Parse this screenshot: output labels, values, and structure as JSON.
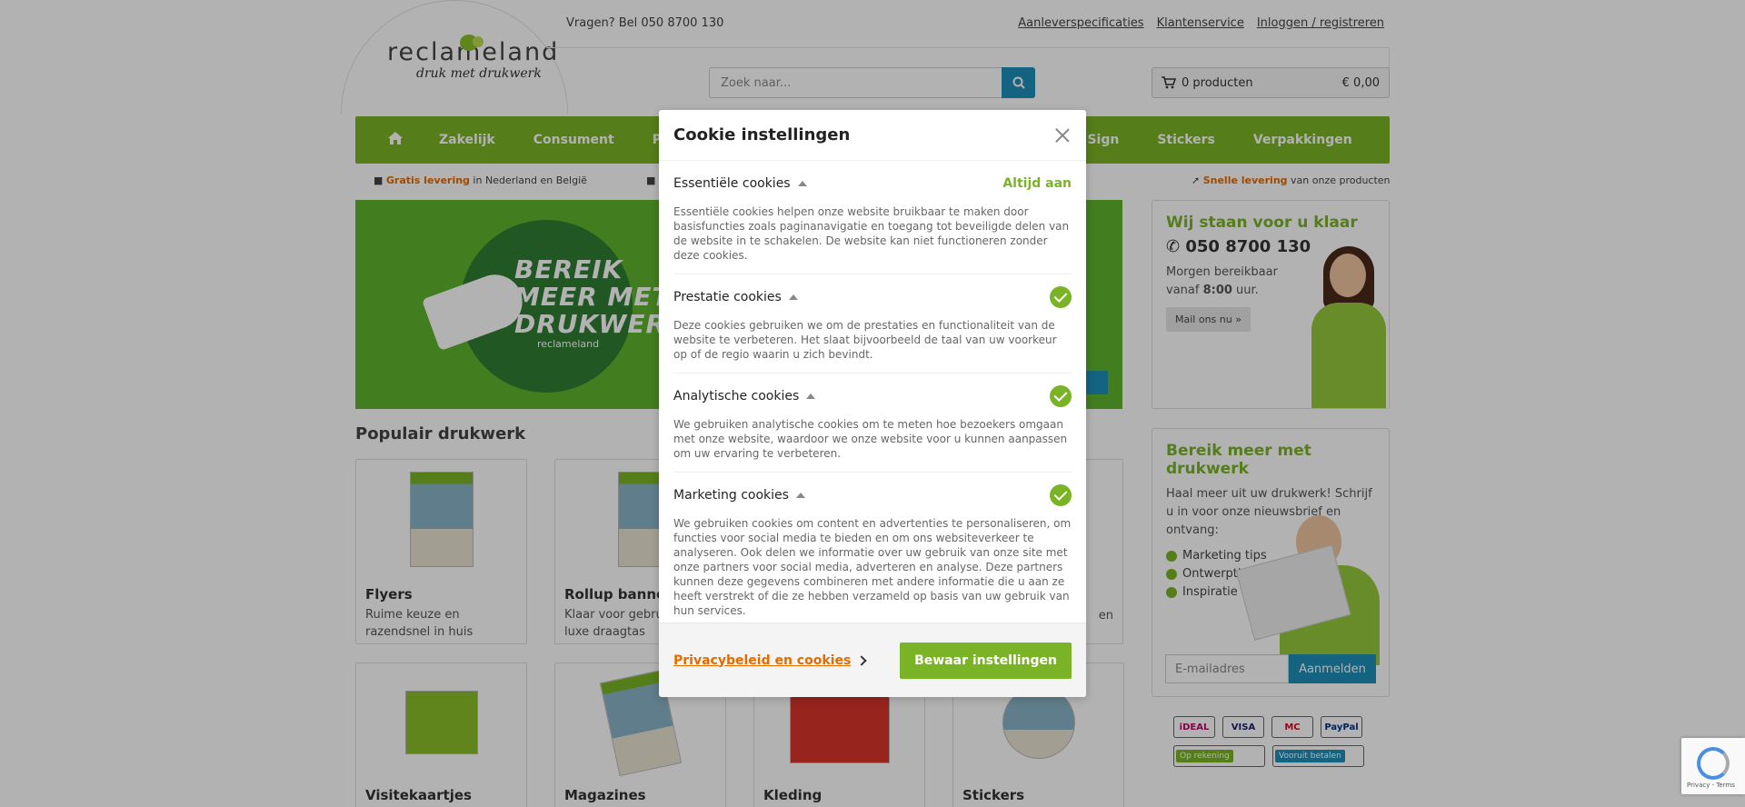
{
  "header": {
    "phone_text": "Vragen? Bel 050 8700 130",
    "links": [
      "Aanleverspecificaties",
      "Klantenservice",
      "Inloggen / registreren"
    ],
    "logo_word": "reclameland",
    "logo_tagline": "druk met drukwerk",
    "search_placeholder": "Zoek naar...",
    "cart_count": "0 producten",
    "cart_total": "€ 0,00"
  },
  "nav": {
    "items": [
      "Zakelijk",
      "Consument",
      "Pro",
      "Sign",
      "Stickers",
      "Verpakkingen"
    ]
  },
  "usps": {
    "left_highlight": "Gratis levering",
    "left_rest": " in Nederland en België",
    "right_highlight": "Snelle levering",
    "right_rest": " van onze producten"
  },
  "hero": {
    "text_line1": "BEREIK",
    "text_line2": "MEER MET",
    "text_line3": "DRUKWERK",
    "brand": "reclameland"
  },
  "contact_box": {
    "title": "Wij staan voor u klaar",
    "phone": "050 8700 130",
    "text_prefix": "Morgen bereikbaar vanaf ",
    "time": "8:00",
    "text_suffix": " uur.",
    "button": "Mail ons nu »"
  },
  "newsletter_box": {
    "title": "Bereik meer met drukwerk",
    "text": "Haal meer uit uw drukwerk! Schrijf u in voor onze nieuwsbrief en ontvang:",
    "benefits": [
      "Marketing tips",
      "Ontwerptips",
      "Inspiratie"
    ],
    "input_placeholder": "E-mailadres",
    "button": "Aanmelden"
  },
  "payments": {
    "row1": [
      "iDEAL",
      "VISA",
      "MC",
      "PayPal"
    ],
    "row2": [
      "Op rekening",
      "Vooruit betalen"
    ]
  },
  "products": {
    "section_title": "Populair drukwerk",
    "items": [
      {
        "name": "Flyers",
        "desc": "Ruime keuze en razendsnel in huis"
      },
      {
        "name": "Rollup banners",
        "desc": "Klaar voor gebruik incl. luxe draagtas"
      },
      {
        "name": "Visitekaartjes",
        "desc": ""
      },
      {
        "name": "Magazines",
        "desc": ""
      },
      {
        "name": "Kleding",
        "desc": ""
      },
      {
        "name": "Stickers",
        "desc": ""
      }
    ],
    "partial_right_desc": "en"
  },
  "modal": {
    "title": "Cookie instellingen",
    "sections": [
      {
        "name": "Essentiële cookies",
        "status": "Altijd aan",
        "desc": "Essentiële cookies helpen onze website bruikbaar te maken door basisfuncties zoals paginanavigatie en toegang tot beveiligde delen van de website in te schakelen. De website kan niet functioneren zonder deze cookies."
      },
      {
        "name": "Prestatie cookies",
        "desc": "Deze cookies gebruiken we om de prestaties en functionaliteit van de website te verbeteren. Het slaat bijvoorbeeld de taal van uw voorkeur op of de regio waarin u zich bevindt."
      },
      {
        "name": "Analytische cookies",
        "desc": "We gebruiken analytische cookies om te meten hoe bezoekers omgaan met onze website, waardoor we onze website voor u kunnen aanpassen om uw ervaring te verbeteren."
      },
      {
        "name": "Marketing cookies",
        "desc": "We gebruiken cookies om content en advertenties te personaliseren, om functies voor social media te bieden en om ons websiteverkeer te analyseren. Ook delen we informatie over uw gebruik van onze site met onze partners voor social media, adverteren en analyse. Deze partners kunnen deze gegevens combineren met andere informatie die u aan ze heeft verstrekt of die ze hebben verzameld op basis van uw gebruik van hun services."
      }
    ],
    "privacy_link": "Privacybeleid en cookies",
    "save_button": "Bewaar instellingen"
  },
  "recaptcha": {
    "text": "Privacy - Terms"
  },
  "colors": {
    "brand_green": "#7ab426",
    "accent_blue": "#1d8fb9",
    "accent_orange": "#e26c00"
  }
}
